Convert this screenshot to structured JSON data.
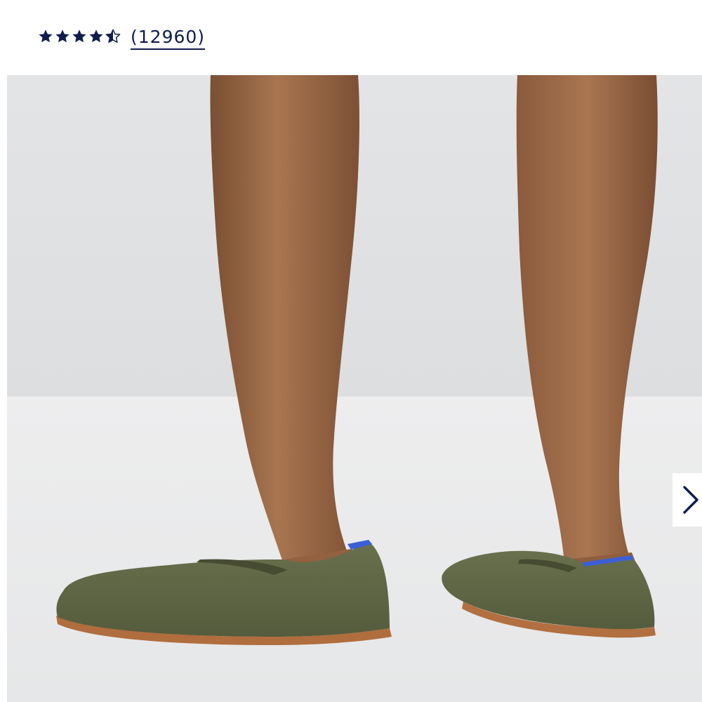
{
  "rating": {
    "value": 4.5,
    "max": 5,
    "review_count_text": "(12960)",
    "star_color": "#0f1c4d"
  },
  "carousel": {
    "next_icon": "chevron-right-icon",
    "background": "#e4e5e6"
  }
}
